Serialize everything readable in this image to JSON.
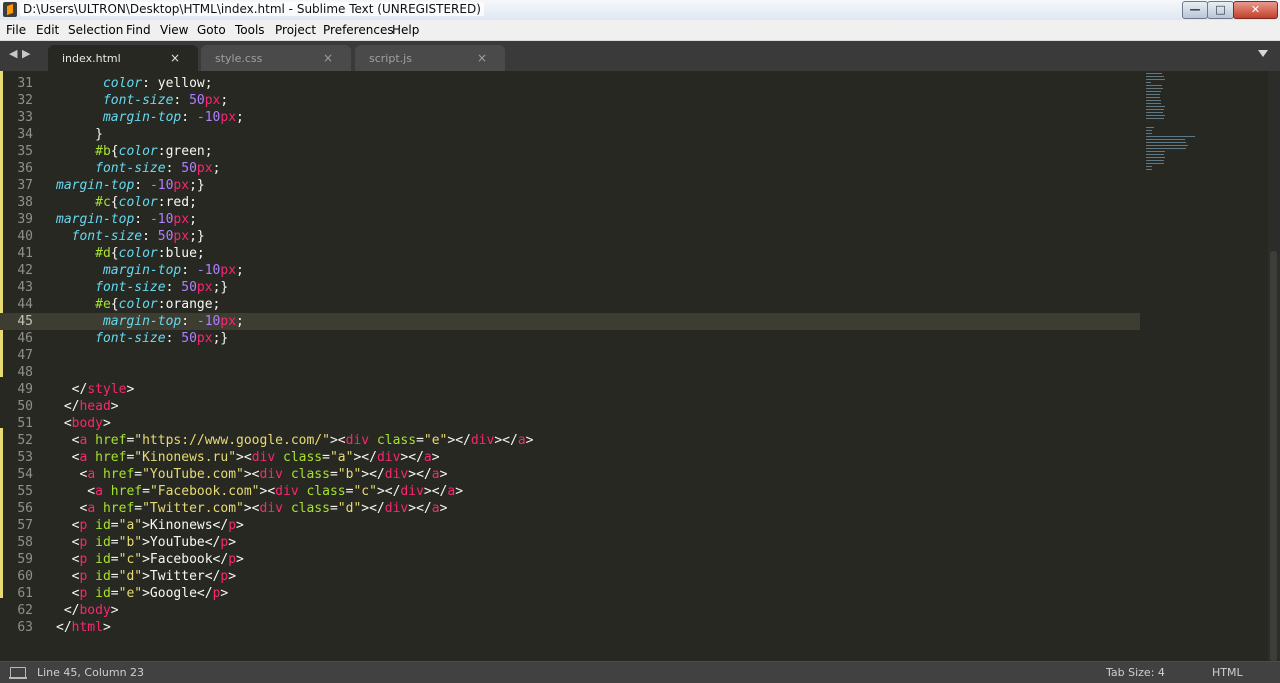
{
  "window": {
    "title": "D:\\Users\\ULTRON\\Desktop\\HTML\\index.html - Sublime Text (UNREGISTERED)",
    "minimize_glyph": "—",
    "maximize_glyph": "□",
    "close_glyph": "✕"
  },
  "menu": [
    "File",
    "Edit",
    "Selection",
    "Find",
    "View",
    "Goto",
    "Tools",
    "Project",
    "Preferences",
    "Help"
  ],
  "tabs": [
    {
      "label": "index.html",
      "active": true
    },
    {
      "label": "style.css",
      "active": false
    },
    {
      "label": "script.js",
      "active": false
    }
  ],
  "tab_close_glyph": "×",
  "editor": {
    "current_line": 45,
    "lines": [
      {
        "n": "31",
        "tokens": [
          [
            "p",
            "      "
          ],
          [
            "kw",
            "color"
          ],
          [
            "p",
            ": yellow;"
          ]
        ]
      },
      {
        "n": "32",
        "tokens": [
          [
            "p",
            "      "
          ],
          [
            "kw",
            "font-size"
          ],
          [
            "p",
            ": "
          ],
          [
            "n",
            "50"
          ],
          [
            "t",
            "px"
          ],
          [
            "p",
            ";"
          ]
        ]
      },
      {
        "n": "33",
        "tokens": [
          [
            "p",
            "      "
          ],
          [
            "kw",
            "margin-top"
          ],
          [
            "p",
            ": "
          ],
          [
            "n",
            "-10"
          ],
          [
            "t",
            "px"
          ],
          [
            "p",
            ";"
          ]
        ]
      },
      {
        "n": "34",
        "tokens": [
          [
            "p",
            "     }"
          ]
        ]
      },
      {
        "n": "35",
        "tokens": [
          [
            "p",
            "     "
          ],
          [
            "sel",
            "#b"
          ],
          [
            "p",
            "{"
          ],
          [
            "kw",
            "color"
          ],
          [
            "p",
            ":green;"
          ]
        ]
      },
      {
        "n": "36",
        "tokens": [
          [
            "p",
            "     "
          ],
          [
            "kw",
            "font-size"
          ],
          [
            "p",
            ": "
          ],
          [
            "n",
            "50"
          ],
          [
            "t",
            "px"
          ],
          [
            "p",
            ";"
          ]
        ]
      },
      {
        "n": "37",
        "tokens": [
          [
            "kw",
            "margin-top"
          ],
          [
            "p",
            ": "
          ],
          [
            "n",
            "-10"
          ],
          [
            "t",
            "px"
          ],
          [
            "p",
            ";}"
          ]
        ]
      },
      {
        "n": "38",
        "tokens": [
          [
            "p",
            "     "
          ],
          [
            "sel",
            "#c"
          ],
          [
            "p",
            "{"
          ],
          [
            "kw",
            "color"
          ],
          [
            "p",
            ":red;"
          ]
        ]
      },
      {
        "n": "39",
        "tokens": [
          [
            "kw",
            "margin-top"
          ],
          [
            "p",
            ": "
          ],
          [
            "n",
            "-10"
          ],
          [
            "t",
            "px"
          ],
          [
            "p",
            ";"
          ]
        ]
      },
      {
        "n": "40",
        "tokens": [
          [
            "p",
            "  "
          ],
          [
            "kw",
            "font-size"
          ],
          [
            "p",
            ": "
          ],
          [
            "n",
            "50"
          ],
          [
            "t",
            "px"
          ],
          [
            "p",
            ";}"
          ]
        ]
      },
      {
        "n": "41",
        "tokens": [
          [
            "p",
            "     "
          ],
          [
            "sel",
            "#d"
          ],
          [
            "p",
            "{"
          ],
          [
            "kw",
            "color"
          ],
          [
            "p",
            ":blue;"
          ]
        ]
      },
      {
        "n": "42",
        "tokens": [
          [
            "p",
            "      "
          ],
          [
            "kw",
            "margin-top"
          ],
          [
            "p",
            ": "
          ],
          [
            "n",
            "-10"
          ],
          [
            "t",
            "px"
          ],
          [
            "p",
            ";"
          ]
        ]
      },
      {
        "n": "43",
        "tokens": [
          [
            "p",
            "     "
          ],
          [
            "kw",
            "font-size"
          ],
          [
            "p",
            ": "
          ],
          [
            "n",
            "50"
          ],
          [
            "t",
            "px"
          ],
          [
            "p",
            ";}"
          ]
        ]
      },
      {
        "n": "44",
        "tokens": [
          [
            "p",
            "     "
          ],
          [
            "sel",
            "#e"
          ],
          [
            "p",
            "{"
          ],
          [
            "kw",
            "color"
          ],
          [
            "p",
            ":orange;"
          ]
        ]
      },
      {
        "n": "45",
        "tokens": [
          [
            "p",
            "      "
          ],
          [
            "kw",
            "margin-top"
          ],
          [
            "p",
            ": "
          ],
          [
            "n",
            "-10"
          ],
          [
            "t",
            "px"
          ],
          [
            "p",
            ";"
          ]
        ]
      },
      {
        "n": "46",
        "tokens": [
          [
            "p",
            "     "
          ],
          [
            "kw",
            "font-size"
          ],
          [
            "p",
            ": "
          ],
          [
            "n",
            "50"
          ],
          [
            "t",
            "px"
          ],
          [
            "p",
            ";}"
          ]
        ]
      },
      {
        "n": "47",
        "tokens": []
      },
      {
        "n": "48",
        "tokens": []
      },
      {
        "n": "49",
        "tokens": [
          [
            "p",
            "  </"
          ],
          [
            "t",
            "style"
          ],
          [
            "p",
            ">"
          ]
        ]
      },
      {
        "n": "50",
        "tokens": [
          [
            "p",
            " </"
          ],
          [
            "t",
            "head"
          ],
          [
            "p",
            ">"
          ]
        ]
      },
      {
        "n": "51",
        "tokens": [
          [
            "p",
            " <"
          ],
          [
            "t",
            "body"
          ],
          [
            "p",
            ">"
          ]
        ]
      },
      {
        "n": "52",
        "tokens": [
          [
            "p",
            "  <"
          ],
          [
            "t",
            "a"
          ],
          [
            "p",
            " "
          ],
          [
            "a",
            "href"
          ],
          [
            "p",
            "="
          ],
          [
            "s",
            "\"https://www.google.com/\""
          ],
          [
            "p",
            "><"
          ],
          [
            "t",
            "div"
          ],
          [
            "p",
            " "
          ],
          [
            "a",
            "class"
          ],
          [
            "p",
            "="
          ],
          [
            "s",
            "\"e\""
          ],
          [
            "p",
            "></"
          ],
          [
            "t",
            "div"
          ],
          [
            "p",
            "></"
          ],
          [
            "t",
            "a"
          ],
          [
            "p",
            ">"
          ]
        ]
      },
      {
        "n": "53",
        "tokens": [
          [
            "p",
            "  <"
          ],
          [
            "t",
            "a"
          ],
          [
            "p",
            " "
          ],
          [
            "a",
            "href"
          ],
          [
            "p",
            "="
          ],
          [
            "s",
            "\"Kinonews.ru\""
          ],
          [
            "p",
            "><"
          ],
          [
            "t",
            "div"
          ],
          [
            "p",
            " "
          ],
          [
            "a",
            "class"
          ],
          [
            "p",
            "="
          ],
          [
            "s",
            "\"a\""
          ],
          [
            "p",
            "></"
          ],
          [
            "t",
            "div"
          ],
          [
            "p",
            "></"
          ],
          [
            "t",
            "a"
          ],
          [
            "p",
            ">"
          ]
        ]
      },
      {
        "n": "54",
        "tokens": [
          [
            "p",
            "   <"
          ],
          [
            "t",
            "a"
          ],
          [
            "p",
            " "
          ],
          [
            "a",
            "href"
          ],
          [
            "p",
            "="
          ],
          [
            "s",
            "\"YouTube.com\""
          ],
          [
            "p",
            "><"
          ],
          [
            "t",
            "div"
          ],
          [
            "p",
            " "
          ],
          [
            "a",
            "class"
          ],
          [
            "p",
            "="
          ],
          [
            "s",
            "\"b\""
          ],
          [
            "p",
            "></"
          ],
          [
            "t",
            "div"
          ],
          [
            "p",
            "></"
          ],
          [
            "t",
            "a"
          ],
          [
            "p",
            ">"
          ]
        ]
      },
      {
        "n": "55",
        "tokens": [
          [
            "p",
            "    <"
          ],
          [
            "t",
            "a"
          ],
          [
            "p",
            " "
          ],
          [
            "a",
            "href"
          ],
          [
            "p",
            "="
          ],
          [
            "s",
            "\"Facebook.com\""
          ],
          [
            "p",
            "><"
          ],
          [
            "t",
            "div"
          ],
          [
            "p",
            " "
          ],
          [
            "a",
            "class"
          ],
          [
            "p",
            "="
          ],
          [
            "s",
            "\"c\""
          ],
          [
            "p",
            "></"
          ],
          [
            "t",
            "div"
          ],
          [
            "p",
            "></"
          ],
          [
            "t",
            "a"
          ],
          [
            "p",
            ">"
          ]
        ]
      },
      {
        "n": "56",
        "tokens": [
          [
            "p",
            "   <"
          ],
          [
            "t",
            "a"
          ],
          [
            "p",
            " "
          ],
          [
            "a",
            "href"
          ],
          [
            "p",
            "="
          ],
          [
            "s",
            "\"Twitter.com\""
          ],
          [
            "p",
            "><"
          ],
          [
            "t",
            "div"
          ],
          [
            "p",
            " "
          ],
          [
            "a",
            "class"
          ],
          [
            "p",
            "="
          ],
          [
            "s",
            "\"d\""
          ],
          [
            "p",
            "></"
          ],
          [
            "t",
            "div"
          ],
          [
            "p",
            "></"
          ],
          [
            "t",
            "a"
          ],
          [
            "p",
            ">"
          ]
        ]
      },
      {
        "n": "57",
        "tokens": [
          [
            "p",
            "  <"
          ],
          [
            "t",
            "p"
          ],
          [
            "p",
            " "
          ],
          [
            "a",
            "id"
          ],
          [
            "p",
            "="
          ],
          [
            "s",
            "\"a\""
          ],
          [
            "p",
            ">Kinonews</"
          ],
          [
            "t",
            "p"
          ],
          [
            "p",
            ">"
          ]
        ]
      },
      {
        "n": "58",
        "tokens": [
          [
            "p",
            "  <"
          ],
          [
            "t",
            "p"
          ],
          [
            "p",
            " "
          ],
          [
            "a",
            "id"
          ],
          [
            "p",
            "="
          ],
          [
            "s",
            "\"b\""
          ],
          [
            "p",
            ">YouTube</"
          ],
          [
            "t",
            "p"
          ],
          [
            "p",
            ">"
          ]
        ]
      },
      {
        "n": "59",
        "tokens": [
          [
            "p",
            "  <"
          ],
          [
            "t",
            "p"
          ],
          [
            "p",
            " "
          ],
          [
            "a",
            "id"
          ],
          [
            "p",
            "="
          ],
          [
            "s",
            "\"c\""
          ],
          [
            "p",
            ">Facebook</"
          ],
          [
            "t",
            "p"
          ],
          [
            "p",
            ">"
          ]
        ]
      },
      {
        "n": "60",
        "tokens": [
          [
            "p",
            "  <"
          ],
          [
            "t",
            "p"
          ],
          [
            "p",
            " "
          ],
          [
            "a",
            "id"
          ],
          [
            "p",
            "="
          ],
          [
            "s",
            "\"d\""
          ],
          [
            "p",
            ">Twitter</"
          ],
          [
            "t",
            "p"
          ],
          [
            "p",
            ">"
          ]
        ]
      },
      {
        "n": "61",
        "tokens": [
          [
            "p",
            "  <"
          ],
          [
            "t",
            "p"
          ],
          [
            "p",
            " "
          ],
          [
            "a",
            "id"
          ],
          [
            "p",
            "="
          ],
          [
            "s",
            "\"e\""
          ],
          [
            "p",
            ">Google</"
          ],
          [
            "t",
            "p"
          ],
          [
            "p",
            ">"
          ]
        ]
      },
      {
        "n": "62",
        "tokens": [
          [
            "p",
            " </"
          ],
          [
            "t",
            "body"
          ],
          [
            "p",
            ">"
          ]
        ]
      },
      {
        "n": "63",
        "tokens": [
          [
            "p",
            "</"
          ],
          [
            "t",
            "html"
          ],
          [
            "p",
            ">"
          ]
        ]
      }
    ]
  },
  "status": {
    "position": "Line 45, Column 23",
    "tab_size": "Tab Size: 4",
    "syntax": "HTML"
  },
  "colors": {
    "background": "#272822",
    "tag": "#f92672",
    "attribute": "#a6e22e",
    "string": "#e6db74",
    "property": "#66d9ef",
    "number": "#ae81ff"
  }
}
